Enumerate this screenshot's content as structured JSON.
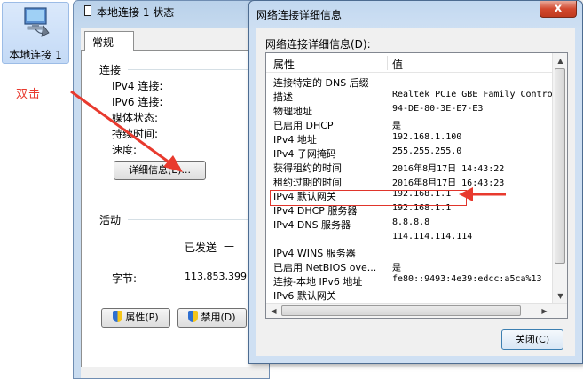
{
  "desktop": {
    "icon_label": "本地连接 1",
    "annotation": "双击"
  },
  "status_window": {
    "title": "本地连接 1 状态",
    "tab": "常规",
    "connection_section": "连接",
    "labels": [
      "IPv4 连接:",
      "IPv6 连接:",
      "媒体状态:",
      "持续时间:",
      "速度:"
    ],
    "details_button": "详细信息(E)...",
    "activity_section": "活动",
    "sent_label": "已发送",
    "sent_dash": "—",
    "bytes_label": "字节:",
    "bytes_sent": "113,853,399",
    "properties_button": "属性(P)",
    "disable_button": "禁用(D)"
  },
  "details_window": {
    "title": "网络连接详细信息",
    "close_x": "x",
    "heading": "网络连接详细信息(D):",
    "columns": {
      "property": "属性",
      "value": "值"
    },
    "rows": [
      {
        "k": "连接特定的 DNS 后缀",
        "v": ""
      },
      {
        "k": "描述",
        "v": "Realtek PCIe GBE Family Contro"
      },
      {
        "k": "物理地址",
        "v": "94-DE-80-3E-E7-E3"
      },
      {
        "k": "已启用 DHCP",
        "v": "是"
      },
      {
        "k": "IPv4 地址",
        "v": "192.168.1.100"
      },
      {
        "k": "IPv4 子网掩码",
        "v": "255.255.255.0"
      },
      {
        "k": "获得租约的时间",
        "v": "2016年8月17日 14:43:22"
      },
      {
        "k": "租约过期的时间",
        "v": "2016年8月17日 16:43:23"
      },
      {
        "k": "IPv4 默认网关",
        "v": "192.168.1.1"
      },
      {
        "k": "IPv4 DHCP 服务器",
        "v": "192.168.1.1"
      },
      {
        "k": "IPv4 DNS 服务器",
        "v": "8.8.8.8"
      },
      {
        "k": "",
        "v": "114.114.114.114"
      },
      {
        "k": "IPv4 WINS 服务器",
        "v": ""
      },
      {
        "k": "已启用 NetBIOS ove...",
        "v": "是"
      },
      {
        "k": "连接-本地 IPv6 地址",
        "v": "fe80::9493:4e39:edcc:a5ca%13"
      },
      {
        "k": "IPv6 默认网关",
        "v": ""
      }
    ],
    "close_button": "关闭(C)"
  },
  "colors": {
    "annotation_red": "#e83a2e",
    "highlight_red": "#e0352b"
  }
}
